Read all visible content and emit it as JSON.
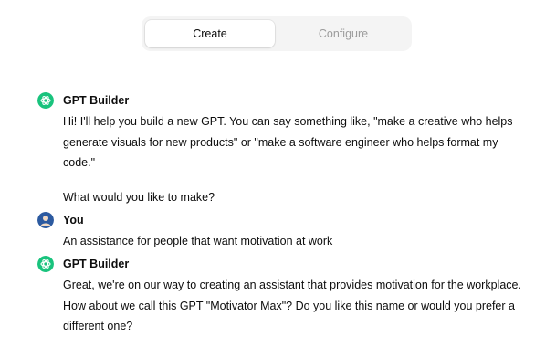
{
  "tabs": [
    {
      "label": "Create",
      "active": true
    },
    {
      "label": "Configure",
      "active": false
    }
  ],
  "messages": [
    {
      "author": "GPT Builder",
      "avatar_icon": "gpt-logo-icon",
      "avatar_color": "#19c37d",
      "paragraphs": [
        "Hi! I'll help you build a new GPT. You can say something like, \"make a creative who helps generate visuals for new products\" or \"make a software engineer who helps format my code.\"",
        "What would you like to make?"
      ]
    },
    {
      "author": "You",
      "avatar_icon": "user-avatar-icon",
      "avatar_color": "#2c5aa0",
      "paragraphs": [
        "An assistance for people that want motivation at work"
      ]
    },
    {
      "author": "GPT Builder",
      "avatar_icon": "gpt-logo-icon",
      "avatar_color": "#19c37d",
      "paragraphs": [
        "Great, we're on our way to creating an assistant that provides motivation for the workplace. How about we call this GPT \"Motivator Max\"? Do you like this name or would you prefer a different one?"
      ]
    }
  ]
}
